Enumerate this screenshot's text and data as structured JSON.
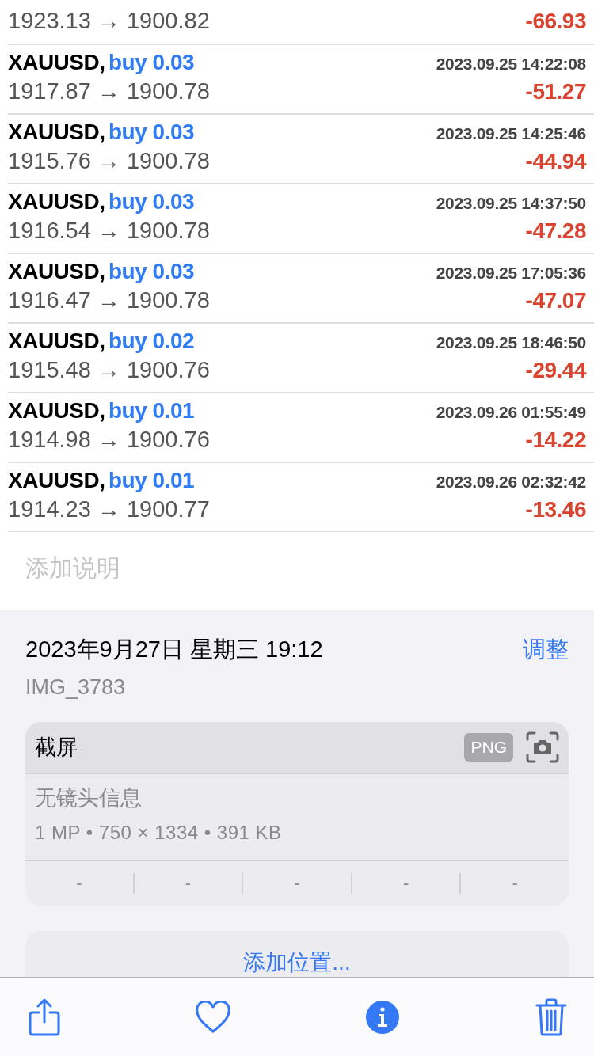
{
  "photo": {
    "top_fragment": {
      "prices": "1923.13 → 1900.82",
      "profit": "-66.93"
    },
    "trades": [
      {
        "symbol": "XAUUSD,",
        "order": "buy 0.03",
        "time": "2023.09.25 14:22:08",
        "prices": "1917.87 → 1900.78",
        "profit": "-51.27"
      },
      {
        "symbol": "XAUUSD,",
        "order": "buy 0.03",
        "time": "2023.09.25 14:25:46",
        "prices": "1915.76 → 1900.78",
        "profit": "-44.94"
      },
      {
        "symbol": "XAUUSD,",
        "order": "buy 0.03",
        "time": "2023.09.25 14:37:50",
        "prices": "1916.54 → 1900.78",
        "profit": "-47.28"
      },
      {
        "symbol": "XAUUSD,",
        "order": "buy 0.03",
        "time": "2023.09.25 17:05:36",
        "prices": "1916.47 → 1900.78",
        "profit": "-47.07"
      },
      {
        "symbol": "XAUUSD,",
        "order": "buy 0.02",
        "time": "2023.09.25 18:46:50",
        "prices": "1915.48 → 1900.76",
        "profit": "-29.44"
      },
      {
        "symbol": "XAUUSD,",
        "order": "buy 0.01",
        "time": "2023.09.26 01:55:49",
        "prices": "1914.98 → 1900.76",
        "profit": "-14.22"
      },
      {
        "symbol": "XAUUSD,",
        "order": "buy 0.01",
        "time": "2023.09.26 02:32:42",
        "prices": "1914.23 → 1900.77",
        "profit": "-13.46"
      }
    ]
  },
  "caption": {
    "placeholder": "添加说明"
  },
  "info": {
    "datetime": "2023年9月27日 星期三 19:12",
    "adjust": "调整",
    "filename": "IMG_3783"
  },
  "card": {
    "title": "截屏",
    "format": "PNG",
    "lens": "无镜头信息",
    "specs": "1 MP • 750 × 1334 • 391 KB",
    "values": [
      "-",
      "-",
      "-",
      "-",
      "-"
    ]
  },
  "location": {
    "label": "添加位置..."
  },
  "toolbar": [
    {
      "kind": "share"
    },
    {
      "kind": "favorite",
      "selected": false
    },
    {
      "kind": "info",
      "selected": true
    },
    {
      "kind": "delete"
    }
  ]
}
